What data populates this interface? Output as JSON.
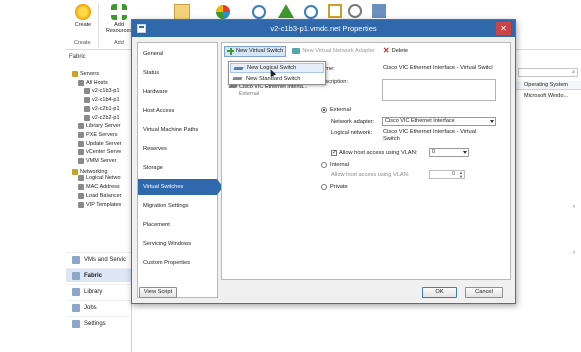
{
  "ribbon": {
    "buttons": [
      {
        "label": "Create",
        "icon": "star-burst-icon",
        "color": "#f0b400"
      },
      {
        "label": "Add Resources",
        "icon": "green-plus-icon",
        "color": "#3c9a2d"
      }
    ],
    "groups": [
      "Create",
      "Add"
    ]
  },
  "sidebar": {
    "header": "Fabric",
    "tree": [
      {
        "label": "Servers",
        "indent": 0
      },
      {
        "label": "All Hosts",
        "indent": 1
      },
      {
        "label": "v2-c1b3-p1",
        "indent": 2
      },
      {
        "label": "v2-c1b4-p1",
        "indent": 2
      },
      {
        "label": "v2-c2b1-p1",
        "indent": 2
      },
      {
        "label": "v2-c2b2-p1",
        "indent": 2
      },
      {
        "label": "Library Server",
        "indent": 1
      },
      {
        "label": "PXE Servers",
        "indent": 1
      },
      {
        "label": "Update Server",
        "indent": 1
      },
      {
        "label": "vCenter Serve",
        "indent": 1
      },
      {
        "label": "VMM Server",
        "indent": 1
      },
      {
        "label": "Networking",
        "indent": 0
      },
      {
        "label": "Logical Netwo",
        "indent": 1
      },
      {
        "label": "MAC Address",
        "indent": 1
      },
      {
        "label": "Load Balancer",
        "indent": 1
      },
      {
        "label": "VIP Templates",
        "indent": 1
      }
    ],
    "workspaces": [
      {
        "label": "VMs and Servic",
        "active": false
      },
      {
        "label": "Fabric",
        "active": true
      },
      {
        "label": "Library",
        "active": false
      },
      {
        "label": "Jobs",
        "active": false
      },
      {
        "label": "Settings",
        "active": false
      }
    ]
  },
  "main": {
    "column_header": "Operating System",
    "cell": "Microsoft Windo..."
  },
  "dialog": {
    "title": "v2-c1b3-p1.vmdc.net Properties",
    "close_glyph": "✕",
    "nav": [
      "General",
      "Status",
      "Hardware",
      "Host Access",
      "Virtual Machine Paths",
      "Reserves",
      "Storage",
      "Virtual Switches",
      "Migration Settings",
      "Placement",
      "Servicing Windows",
      "Custom Properties"
    ],
    "selected_nav": "Virtual Switches",
    "toolbar": {
      "new_virtual_switch": "New Virtual Switch",
      "new_virtual_network_adapter": "New Virtual Network Adapter",
      "delete": "Delete"
    },
    "dropdown": {
      "items": [
        "New Logical Switch",
        "New Standard Switch"
      ]
    },
    "switch_list": [
      {
        "name": "Cisco VIC Ethernet Interfa...",
        "type": "External"
      }
    ],
    "form": {
      "name_label": "Name:",
      "name_value": "Cisco VIC Ethernet Interface - Virtual Switcl",
      "description_label": "Description:",
      "external_label": "External",
      "network_adapter_label": "Network adapter:",
      "network_adapter_value": "Cisco VIC Ethernet Interface",
      "logical_network_label": "Logical network:",
      "logical_network_value": "Cisco VIC Ethernet Interface - Virtual Switch",
      "allow_vlan_label": "Allow host access using VLAN:",
      "allow_vlan_value": "0",
      "internal_label": "Internal",
      "internal_vlan_label": "Allow host access using VLAN:",
      "internal_vlan_value": "0",
      "private_label": "Private"
    },
    "footer": {
      "view_script": "View Script",
      "ok": "OK",
      "cancel": "Cancel"
    },
    "accent_color": "#2f69ab"
  }
}
